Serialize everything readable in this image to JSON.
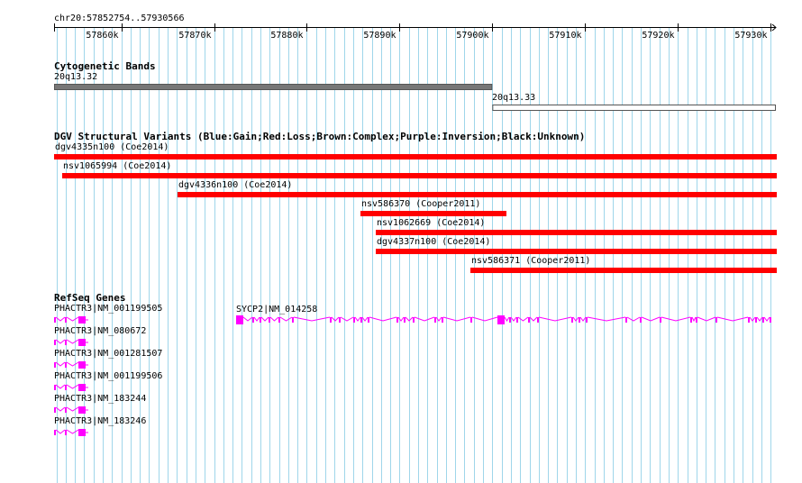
{
  "ruler": {
    "label": "chr20:57852754..57930566",
    "start": 57852754,
    "end": 57930566,
    "ticks": [
      {
        "pos": 57860000,
        "label": "57860k"
      },
      {
        "pos": 57870000,
        "label": "57870k"
      },
      {
        "pos": 57880000,
        "label": "57880k"
      },
      {
        "pos": 57890000,
        "label": "57890k"
      },
      {
        "pos": 57900000,
        "label": "57900k"
      },
      {
        "pos": 57910000,
        "label": "57910k"
      },
      {
        "pos": 57920000,
        "label": "57920k"
      },
      {
        "pos": 57930000,
        "label": "57930k"
      }
    ]
  },
  "colors": {
    "grid": "#9fd6ea",
    "band_gray": "#777777",
    "cnv_loss": "#ff0000",
    "gene": "#ff00ff",
    "axis": "#000000"
  },
  "tracks": {
    "cytoband": {
      "title": "Cytogenetic Bands",
      "bands": [
        {
          "name": "20q13.32",
          "start": 57852754,
          "end": 57900000,
          "fill": "#777777"
        },
        {
          "name": "20q13.33",
          "start": 57900000,
          "end": 57930566,
          "fill": "#ffffff"
        }
      ]
    },
    "dgv": {
      "title": "DGV Structural Variants (Blue:Gain;Red:Loss;Brown:Complex;Purple:Inversion;Black:Unknown)",
      "variants": [
        {
          "label": "dgv4335n100 (Coe2014)",
          "start": 57852754,
          "end": 57930566,
          "type": "loss"
        },
        {
          "label": "nsv1065994 (Coe2014)",
          "start": 57853580,
          "end": 57930566,
          "type": "loss"
        },
        {
          "label": "dgv4336n100 (Coe2014)",
          "start": 57866100,
          "end": 57930566,
          "type": "loss"
        },
        {
          "label": "nsv586370 (Cooper2011)",
          "start": 57885740,
          "end": 57901450,
          "type": "loss"
        },
        {
          "label": "nsv1062669 (Coe2014)",
          "start": 57887460,
          "end": 57930566,
          "type": "loss"
        },
        {
          "label": "dgv4337n100 (Coe2014)",
          "start": 57887460,
          "end": 57930566,
          "type": "loss"
        },
        {
          "label": "nsv586371 (Cooper2011)",
          "start": 57897620,
          "end": 57930566,
          "type": "loss"
        }
      ]
    },
    "refseq": {
      "title": "RefSeq Genes",
      "genes": [
        {
          "label": "PHACTR3|NM_001199505",
          "start": 57852754,
          "end": 57856480
        },
        {
          "label": "PHACTR3|NM_080672",
          "start": 57852754,
          "end": 57856480
        },
        {
          "label": "PHACTR3|NM_001281507",
          "start": 57852754,
          "end": 57856480
        },
        {
          "label": "PHACTR3|NM_001199506",
          "start": 57852754,
          "end": 57856480
        },
        {
          "label": "PHACTR3|NM_183244",
          "start": 57852754,
          "end": 57856480
        },
        {
          "label": "PHACTR3|NM_183246",
          "start": 57852754,
          "end": 57856480
        },
        {
          "label": "SYCP2|NM_014258",
          "start": 57872350,
          "end": 57930566
        }
      ]
    }
  }
}
